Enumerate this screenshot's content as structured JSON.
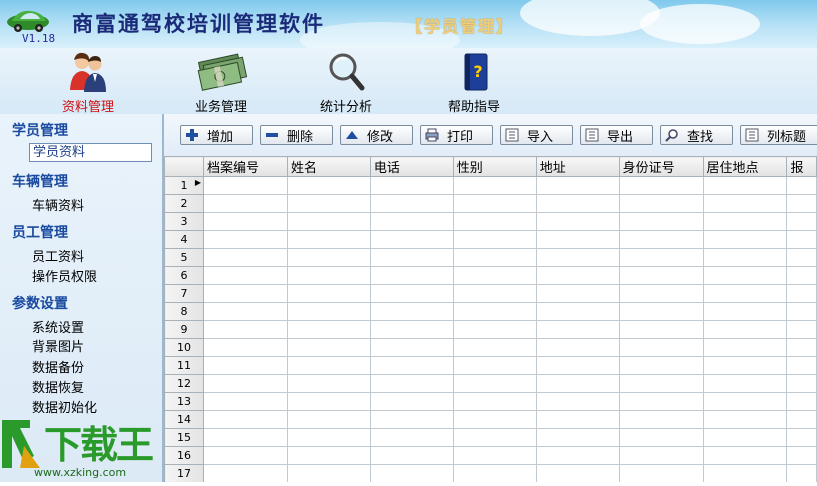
{
  "app": {
    "title": "商富通驾校培训管理软件",
    "version": "V1.18",
    "module_tag": "【学员管理】"
  },
  "toolbar": [
    {
      "id": "records",
      "label": "资料管理",
      "icon": "people-icon",
      "active": true
    },
    {
      "id": "business",
      "label": "业务管理",
      "icon": "money-icon",
      "active": false
    },
    {
      "id": "stats",
      "label": "统计分析",
      "icon": "magnifier-icon",
      "active": false
    },
    {
      "id": "help",
      "label": "帮助指导",
      "icon": "help-book-icon",
      "active": false
    }
  ],
  "sidebar": {
    "groups": [
      {
        "title": "学员管理",
        "items": [
          "学员资料"
        ]
      },
      {
        "title": "车辆管理",
        "items": [
          "车辆资料"
        ]
      },
      {
        "title": "员工管理",
        "items": [
          "员工资料",
          "操作员权限"
        ]
      },
      {
        "title": "参数设置",
        "items": [
          "系统设置",
          "背景图片",
          "数据备份",
          "数据恢复",
          "数据初始化"
        ]
      }
    ],
    "selected": "学员资料"
  },
  "actions": [
    {
      "label": "增加",
      "icon": "plus-icon"
    },
    {
      "label": "删除",
      "icon": "minus-icon"
    },
    {
      "label": "修改",
      "icon": "triangle-up-icon"
    },
    {
      "label": "打印",
      "icon": "printer-icon"
    },
    {
      "label": "导入",
      "icon": "import-icon"
    },
    {
      "label": "导出",
      "icon": "export-icon"
    },
    {
      "label": "查找",
      "icon": "search-icon"
    },
    {
      "label": "列标题",
      "icon": "columns-icon"
    }
  ],
  "grid": {
    "columns": [
      "档案编号",
      "姓名",
      "电话",
      "性别",
      "地址",
      "身份证号",
      "居住地点",
      "报"
    ],
    "row_numbers": [
      "1",
      "2",
      "3",
      "4",
      "5",
      "6",
      "7",
      "8",
      "9",
      "10",
      "11",
      "12",
      "13",
      "14",
      "15",
      "16",
      "17"
    ],
    "current_row": "1"
  },
  "watermark": {
    "text": "下载王",
    "url": "www.xzking.com"
  },
  "colors": {
    "group_title": "#1a4aa0",
    "active_tool": "#d01010",
    "banner_title": "#1a2a78"
  }
}
